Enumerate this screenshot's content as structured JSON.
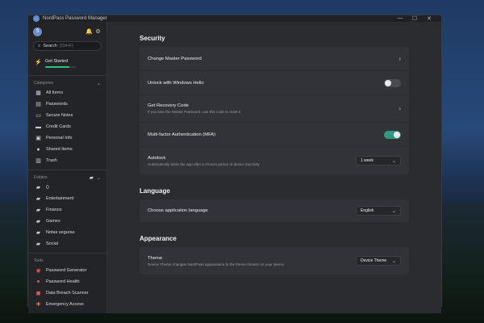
{
  "app": {
    "title": "NordPass Password Manager"
  },
  "window_controls": {
    "minimize": "—",
    "maximize": "☐",
    "close": "✕"
  },
  "sidebar": {
    "avatar_letter": "S",
    "search": {
      "label": "Search",
      "shortcut": "(Ctrl+F)"
    },
    "get_started": {
      "label": "Get Started",
      "progress_fraction": 0.78
    },
    "categories": {
      "title": "Categories",
      "items": [
        {
          "label": "All Items",
          "icon": "grid-icon"
        },
        {
          "label": "Passwords",
          "icon": "key-icon"
        },
        {
          "label": "Secure Notes",
          "icon": "note-icon"
        },
        {
          "label": "Credit Cards",
          "icon": "card-icon"
        },
        {
          "label": "Personal Info",
          "icon": "id-icon"
        },
        {
          "label": "Shared Items",
          "icon": "people-icon"
        },
        {
          "label": "Trash",
          "icon": "trash-icon"
        }
      ]
    },
    "folders": {
      "title": "Folders",
      "items": [
        {
          "label": "()"
        },
        {
          "label": "Entertainment"
        },
        {
          "label": "Finance"
        },
        {
          "label": "Games"
        },
        {
          "label": "Notas seguras"
        },
        {
          "label": "Social"
        }
      ]
    },
    "tools": {
      "title": "Tools",
      "items": [
        {
          "label": "Password Generator",
          "icon": "generator-icon"
        },
        {
          "label": "Password Health",
          "icon": "health-icon"
        },
        {
          "label": "Data Breach Scanner",
          "icon": "scanner-icon"
        },
        {
          "label": "Emergency Access",
          "icon": "emergency-icon"
        }
      ]
    }
  },
  "security": {
    "heading": "Security",
    "change_master": {
      "label": "Change Master Password"
    },
    "unlock_hello": {
      "label": "Unlock with Windows Hello",
      "enabled": false
    },
    "recovery": {
      "label": "Get Recovery Code",
      "sub": "If you lose the Master Password, use this code to reset it"
    },
    "mfa": {
      "label": "Multi-factor Authentication (MFA)",
      "enabled": true
    },
    "autolock": {
      "label": "Autolock",
      "sub": "Automatically locks the app after a chosen period of device inactivity",
      "value": "1 week"
    }
  },
  "language": {
    "heading": "Language",
    "choose": {
      "label": "Choose application language",
      "value": "English"
    }
  },
  "appearance": {
    "heading": "Appearance",
    "theme": {
      "label": "Theme",
      "sub": "Device Theme changes NordPass appearance to the theme chosen on your device",
      "value": "Device Theme"
    }
  },
  "colors": {
    "accent_green": "#2ec07c",
    "toggle_on": "#2e9a81",
    "tool_red": "#e6554d"
  }
}
